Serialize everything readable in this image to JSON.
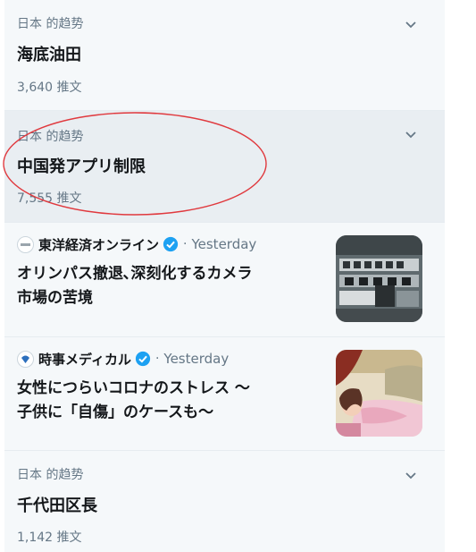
{
  "colors": {
    "secondary_text": "#657786",
    "primary_text": "#14171a",
    "verified_blue": "#1da1f2",
    "highlight_circle": "#e0393e"
  },
  "trends": [
    {
      "category": "日本 的趋势",
      "name": "海底油田",
      "count": "3,640 推文"
    },
    {
      "category": "日本 的趋势",
      "name": "中国発アプリ制限",
      "count": "7,555 推文"
    },
    {
      "category": "日本 的趋势",
      "name": "千代田区長",
      "count": "1,142 推文"
    }
  ],
  "news": [
    {
      "source": "東洋経済オンライン",
      "separator": "·",
      "time": "Yesterday",
      "headline_lines": [
        "オリンパス撤退､深刻化するカメラ",
        "市場の苦境"
      ]
    },
    {
      "source": "時事メディカル",
      "separator": "·",
      "time": "Yesterday",
      "headline_lines": [
        "女性につらいコロナのストレス ～",
        "子供に「自傷」のケースも～"
      ]
    }
  ],
  "icons": {
    "more": "chevron-down-icon",
    "verified": "verified-badge-icon"
  }
}
